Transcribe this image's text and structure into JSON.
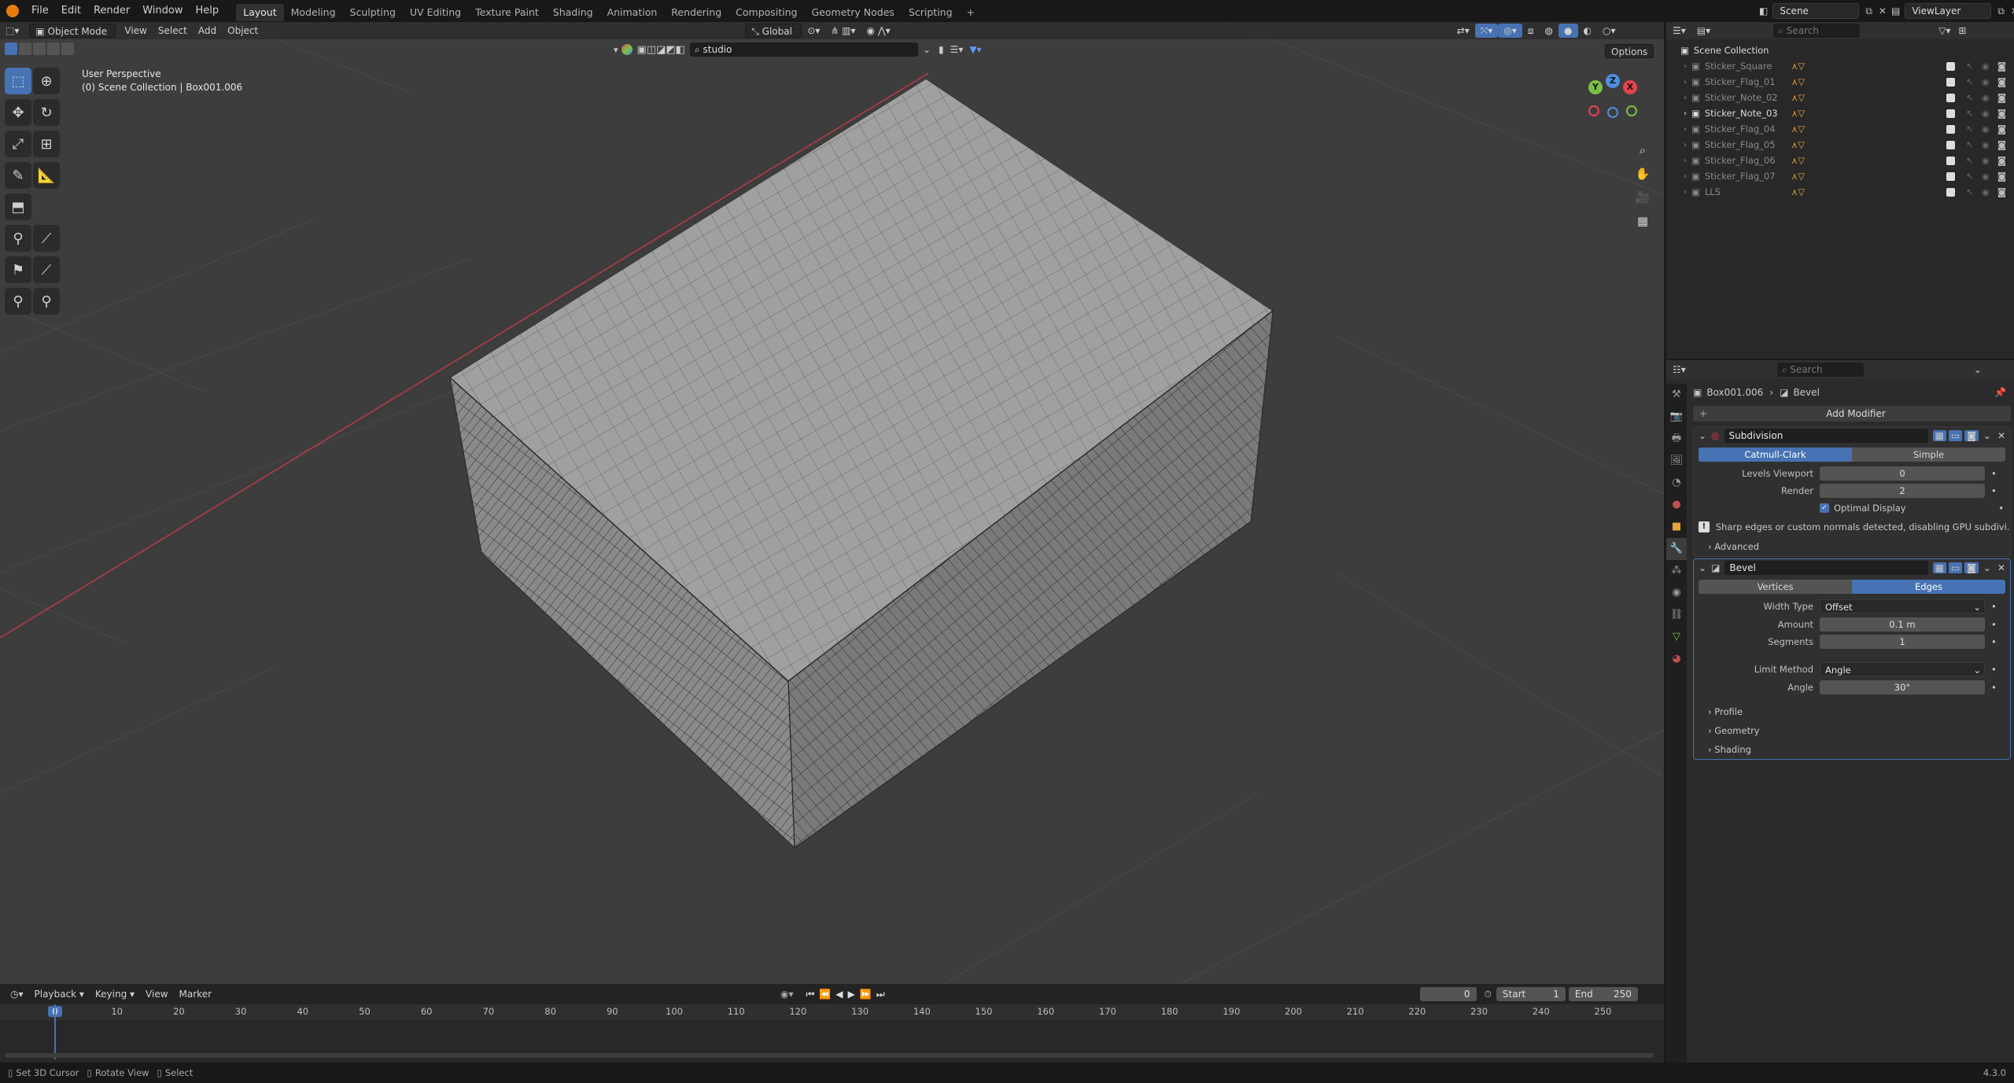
{
  "topbar": {
    "menus": [
      "File",
      "Edit",
      "Render",
      "Window",
      "Help"
    ],
    "workspaces": [
      "Layout",
      "Modeling",
      "Sculpting",
      "UV Editing",
      "Texture Paint",
      "Shading",
      "Animation",
      "Rendering",
      "Compositing",
      "Geometry Nodes",
      "Scripting"
    ],
    "active_workspace": "Layout",
    "add_tab": "+",
    "scene": "Scene",
    "view_layer": "ViewLayer"
  },
  "viewport": {
    "mode": "Object Mode",
    "menus": [
      "View",
      "Select",
      "Add",
      "Object"
    ],
    "orientation": "Global",
    "search_value": "studio",
    "options_label": "Options",
    "perspective_label": "User Perspective",
    "collection_label": "(0) Scene Collection | Box001.006",
    "gizmo": {
      "x": "X",
      "y": "Y",
      "z": "Z"
    }
  },
  "outliner": {
    "search_placeholder": "Search",
    "root": "Scene Collection",
    "items": [
      {
        "name": "Sticker_Square"
      },
      {
        "name": "Sticker_Flag_01"
      },
      {
        "name": "Sticker_Note_02"
      },
      {
        "name": "Sticker_Note_03"
      },
      {
        "name": "Sticker_Flag_04"
      },
      {
        "name": "Sticker_Flag_05"
      },
      {
        "name": "Sticker_Flag_06"
      },
      {
        "name": "Sticker_Flag_07"
      },
      {
        "name": "LLS"
      }
    ]
  },
  "properties": {
    "search_placeholder": "Search",
    "breadcrumb_object": "Box001.006",
    "breadcrumb_modifier": "Bevel",
    "add_modifier": "Add Modifier",
    "subdivision": {
      "name": "Subdivision",
      "mode_a": "Catmull-Clark",
      "mode_b": "Simple",
      "levels_viewport_label": "Levels Viewport",
      "levels_viewport": "0",
      "render_label": "Render",
      "render": "2",
      "optimal_display": "Optimal Display",
      "warning": "Sharp edges or custom normals detected, disabling GPU subdivi...",
      "advanced": "Advanced"
    },
    "bevel": {
      "name": "Bevel",
      "mode_a": "Vertices",
      "mode_b": "Edges",
      "width_type_label": "Width Type",
      "width_type": "Offset",
      "amount_label": "Amount",
      "amount": "0.1 m",
      "segments_label": "Segments",
      "segments": "1",
      "limit_method_label": "Limit Method",
      "limit_method": "Angle",
      "angle_label": "Angle",
      "angle": "30°",
      "profile": "Profile",
      "geometry": "Geometry",
      "shading": "Shading"
    }
  },
  "timeline": {
    "menus": [
      "Playback",
      "Keying",
      "View",
      "Marker"
    ],
    "current_frame": "0",
    "start_label": "Start",
    "start": "1",
    "end_label": "End",
    "end": "250",
    "ticks": [
      "0",
      "10",
      "20",
      "30",
      "40",
      "50",
      "60",
      "70",
      "80",
      "90",
      "100",
      "110",
      "120",
      "130",
      "140",
      "150",
      "160",
      "170",
      "180",
      "190",
      "200",
      "210",
      "220",
      "230",
      "240",
      "250"
    ]
  },
  "statusbar": {
    "hint1": "Set 3D Cursor",
    "hint2": "Rotate View",
    "hint3": "Select",
    "version": "4.3.0"
  },
  "colors": {
    "accent": "#4772b3",
    "viewport_bg": "#3d3d3d",
    "x_axis": "#e4424f",
    "y_axis": "#7bc043",
    "z_axis": "#4f8de0"
  }
}
